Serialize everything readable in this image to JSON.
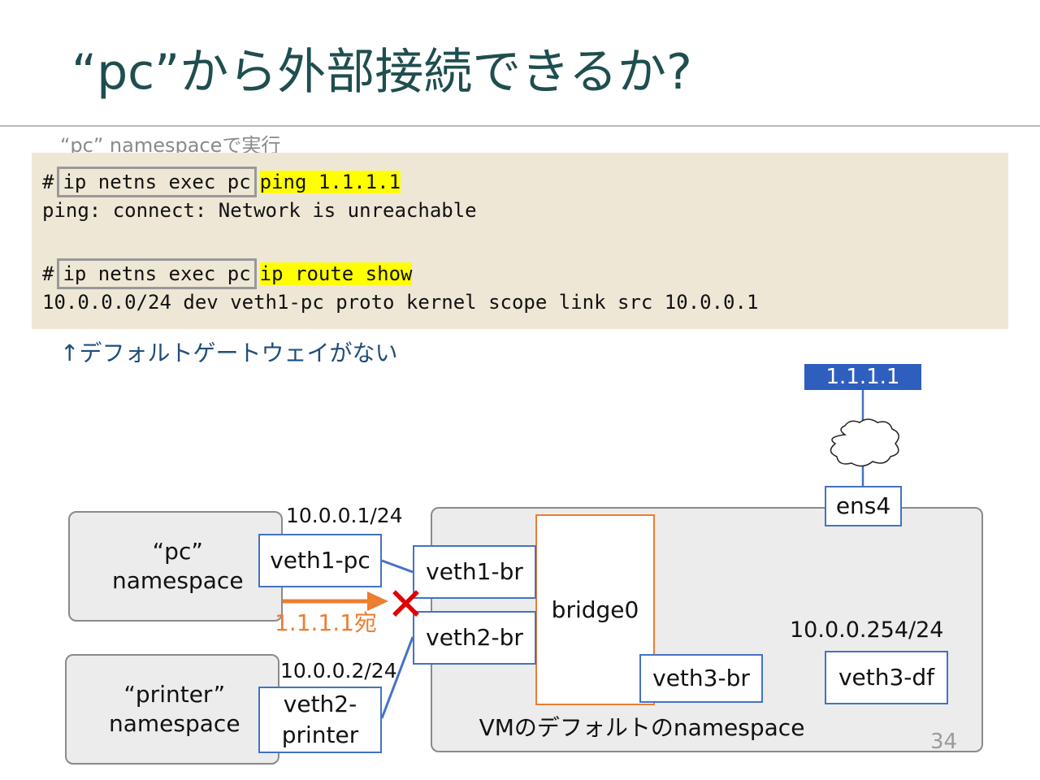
{
  "slide": {
    "title": "“pc”から外部接続できるか?",
    "page_number": "34"
  },
  "terminal": {
    "caption": "“pc” namespaceで実行",
    "lines": [
      {
        "prompt": "#",
        "command": "ip netns exec pc",
        "highlight": "ping 1.1.1.1"
      },
      {
        "output": "ping: connect: Network is unreachable"
      },
      {
        "prompt": "#",
        "command": "ip netns exec pc",
        "highlight": "ip route show"
      },
      {
        "output": "10.0.0.0/24 dev veth1-pc proto kernel scope link src 10.0.0.1"
      }
    ]
  },
  "note": "↑デフォルトゲートウェイがない",
  "diagram": {
    "pc_namespace": "“pc”\nnamespace",
    "printer_namespace": "“printer”\nnamespace",
    "vm_namespace": "VMのデフォルトのnamespace",
    "veth1_pc": "veth1-pc",
    "veth2_printer": "veth2-\nprinter",
    "veth1_br": "veth1-br",
    "veth2_br": "veth2-br",
    "veth3_br": "veth3-br",
    "veth3_df": "veth3-df",
    "bridge": "bridge0",
    "ens4": "ens4",
    "external_ip": "1.1.1.1",
    "ip_pc": "10.0.0.1/24",
    "ip_printer": "10.0.0.2/24",
    "ip_df": "10.0.0.254/24",
    "packet_label": "1.1.1.1宛",
    "blocked_mark": "✕"
  },
  "colors": {
    "title": "#1f4e4e",
    "veth_border": "#4472c4",
    "bridge_border": "#ed7d31",
    "arrow": "#ed7d31",
    "cross": "#e00000",
    "external_box": "#2e5fbf",
    "highlight": "#ffff00",
    "code_bg": "#efe7d6"
  }
}
